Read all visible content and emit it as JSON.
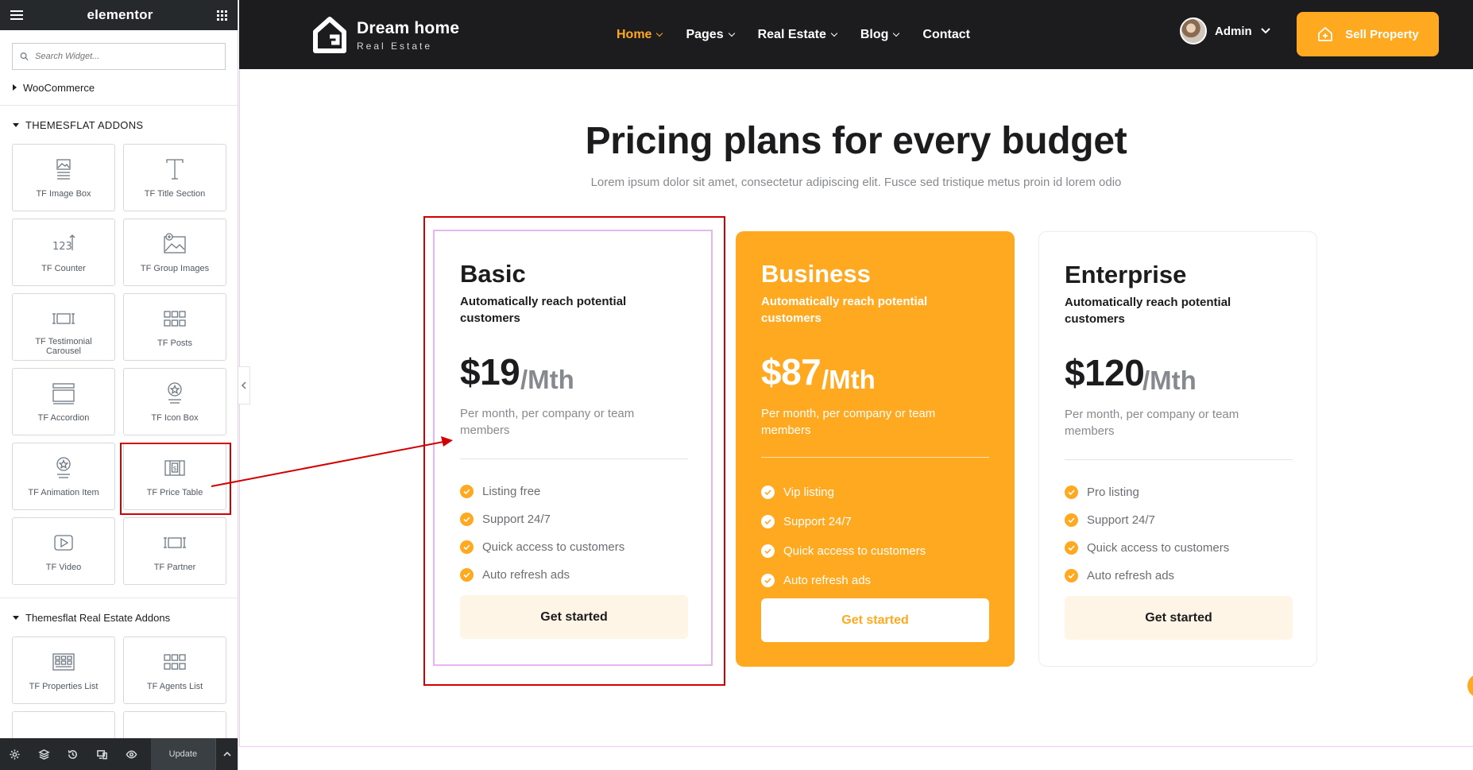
{
  "panel": {
    "brand": "elementor",
    "search_placeholder": "Search Widget...",
    "cat_woocommerce": "WooCommerce",
    "cat_themesflat": "THEMESFLAT ADDONS",
    "widgets": [
      {
        "label": "TF Image Box",
        "icon": "image-box-icon"
      },
      {
        "label": "TF Title Section",
        "icon": "title-icon"
      },
      {
        "label": "TF Counter",
        "icon": "counter-icon"
      },
      {
        "label": "TF Group Images",
        "icon": "group-images-icon"
      },
      {
        "label": "TF Testimonial Carousel",
        "icon": "carousel-icon"
      },
      {
        "label": "TF Posts",
        "icon": "posts-grid-icon"
      },
      {
        "label": "TF Accordion",
        "icon": "accordion-icon"
      },
      {
        "label": "TF Icon Box",
        "icon": "icon-box-icon"
      },
      {
        "label": "TF Animation Item",
        "icon": "animation-item-icon"
      },
      {
        "label": "TF Price Table",
        "icon": "price-table-icon"
      },
      {
        "label": "TF Video",
        "icon": "video-icon"
      },
      {
        "label": "TF Partner",
        "icon": "partner-icon"
      }
    ],
    "cat_realestate": "Themesflat Real Estate Addons",
    "realestate_widgets": [
      {
        "label": "TF Properties List",
        "icon": "properties-list-icon"
      },
      {
        "label": "TF Agents List",
        "icon": "agents-list-icon"
      }
    ],
    "update_label": "Update"
  },
  "site": {
    "logo_title": "Dream home",
    "logo_subtitle": "Real Estate",
    "nav": [
      {
        "label": "Home",
        "dropdown": true,
        "active": true
      },
      {
        "label": "Pages",
        "dropdown": true
      },
      {
        "label": "Real Estate",
        "dropdown": true
      },
      {
        "label": "Blog",
        "dropdown": true
      },
      {
        "label": "Contact",
        "dropdown": false
      }
    ],
    "user_name": "Admin",
    "sell_label": "Sell Property",
    "accent": "#ffa920"
  },
  "pricing": {
    "title": "Pricing plans for every budget",
    "subtitle": "Lorem ipsum dolor sit amet, consectetur adipiscing elit. Fusce sed tristique metus proin id lorem odio",
    "plans": [
      {
        "name": "Basic",
        "tagline": "Automatically reach potential customers",
        "price": "$19",
        "period": "/Mth",
        "description": "Per month, per company or team members",
        "features": [
          "Listing free",
          "Support 24/7",
          "Quick access to customers",
          "Auto refresh ads"
        ],
        "button": "Get started"
      },
      {
        "name": "Business",
        "tagline": "Automatically reach potential customers",
        "price": "$87",
        "period": "/Mth",
        "description": "Per month, per company or team members",
        "features": [
          "Vip listing",
          "Support 24/7",
          "Quick access to customers",
          "Auto refresh ads"
        ],
        "button": "Get started"
      },
      {
        "name": "Enterprise",
        "tagline": "Automatically reach potential customers",
        "price": "$120",
        "period": "/Mth",
        "description": "Per month, per company or team members",
        "features": [
          "Pro listing",
          "Support 24/7",
          "Quick access to customers",
          "Auto refresh ads"
        ],
        "button": "Get started"
      }
    ]
  }
}
